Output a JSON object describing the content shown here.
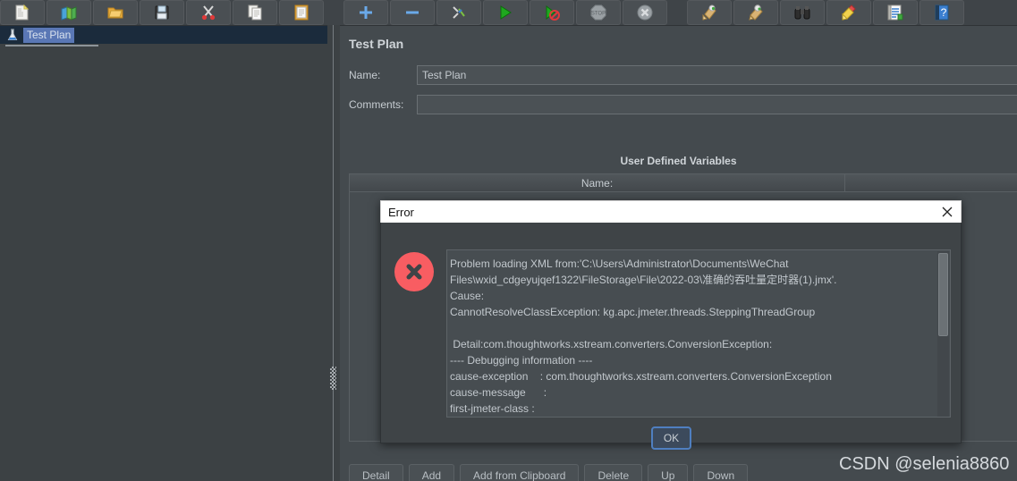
{
  "toolbar": {
    "groups": [
      {
        "buttons": [
          {
            "name": "new-button",
            "icon": "new-document-icon"
          },
          {
            "name": "templates-button",
            "icon": "templates-books-icon"
          },
          {
            "name": "open-button",
            "icon": "open-folder-icon"
          },
          {
            "name": "save-button",
            "icon": "save-floppy-icon"
          },
          {
            "name": "cut-button",
            "icon": "scissors-icon"
          },
          {
            "name": "copy-button",
            "icon": "copy-pages-icon"
          },
          {
            "name": "paste-button",
            "icon": "paste-clipboard-icon"
          }
        ]
      },
      {
        "buttons": [
          {
            "name": "expand-all-button",
            "icon": "plus-icon"
          },
          {
            "name": "collapse-all-button",
            "icon": "minus-icon"
          },
          {
            "name": "toggle-button",
            "icon": "toggle-pencil-icon"
          },
          {
            "name": "start-button",
            "icon": "play-green-icon"
          },
          {
            "name": "start-no-pauses-button",
            "icon": "play-no-pause-icon"
          },
          {
            "name": "stop-button",
            "icon": "stop-sign-icon"
          },
          {
            "name": "shutdown-button",
            "icon": "shutdown-x-icon"
          }
        ]
      },
      {
        "buttons": [
          {
            "name": "clear-button",
            "icon": "broom-clear-icon"
          },
          {
            "name": "clear-all-button",
            "icon": "broom-clear-all-icon"
          },
          {
            "name": "search-button",
            "icon": "binoculars-icon"
          },
          {
            "name": "reset-search-button",
            "icon": "broom-yellow-icon"
          },
          {
            "name": "function-helper-button",
            "icon": "notepad-icon"
          },
          {
            "name": "help-button",
            "icon": "question-help-icon"
          }
        ]
      }
    ]
  },
  "tree": {
    "root_label": "Test Plan",
    "root_icon": "test-plan-flask-icon"
  },
  "panel": {
    "title": "Test Plan",
    "name_label": "Name:",
    "name_value": "Test Plan",
    "comments_label": "Comments:",
    "comments_value": "",
    "udv_title": "User Defined Variables",
    "table_columns": [
      "Name:",
      ""
    ],
    "table_rows": [],
    "buttons": [
      {
        "name": "detail-button",
        "label": "Detail"
      },
      {
        "name": "add-button",
        "label": "Add"
      },
      {
        "name": "add-from-clipboard-button",
        "label": "Add from Clipboard"
      },
      {
        "name": "delete-button",
        "label": "Delete"
      },
      {
        "name": "up-button",
        "label": "Up"
      },
      {
        "name": "down-button",
        "label": "Down"
      }
    ]
  },
  "error_dialog": {
    "title": "Error",
    "close_label": "✕",
    "icon": "error-circle-x-icon",
    "message": "Problem loading XML from:'C:\\Users\\Administrator\\Documents\\WeChat Files\\wxid_cdgeyujqef1322\\FileStorage\\File\\2022-03\\准确的吞吐量定时器(1).jmx'.\nCause:\nCannotResolveClassException: kg.apc.jmeter.threads.SteppingThreadGroup\n\n Detail:com.thoughtworks.xstream.converters.ConversionException:\n---- Debugging information ----\ncause-exception    : com.thoughtworks.xstream.converters.ConversionException\ncause-message      :\nfirst-jmeter-class :",
    "ok_label": "OK"
  },
  "watermark": {
    "text": "CSDN @selenia8860"
  },
  "colors": {
    "app_background": "#444a4e",
    "toolbar_background": "#3f4448",
    "tree_selection": "#5a77b5",
    "error_red": "#f85d62",
    "focus_blue": "#4f7fc0"
  }
}
